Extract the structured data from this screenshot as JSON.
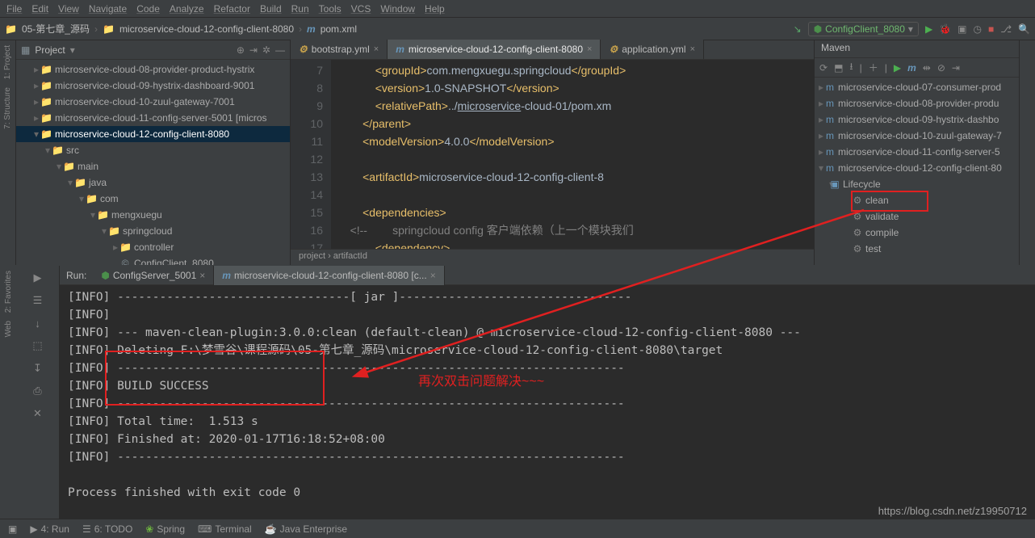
{
  "menu": [
    "File",
    "Edit",
    "View",
    "Navigate",
    "Code",
    "Analyze",
    "Refactor",
    "Build",
    "Run",
    "Tools",
    "VCS",
    "Window",
    "Help"
  ],
  "breadcrumb": {
    "a": "05-第七章_源码",
    "b": "microservice-cloud-12-config-client-8080",
    "c": "pom.xml"
  },
  "runconfig": "ConfigClient_8080",
  "project_label": "Project",
  "tree": [
    {
      "ind": 1,
      "tw": "▸",
      "ic": "📁",
      "t": "microservice-cloud-08-provider-product-hystrix"
    },
    {
      "ind": 1,
      "tw": "▸",
      "ic": "📁",
      "t": "microservice-cloud-09-hystrix-dashboard-9001"
    },
    {
      "ind": 1,
      "tw": "▸",
      "ic": "📁",
      "t": "microservice-cloud-10-zuul-gateway-7001"
    },
    {
      "ind": 1,
      "tw": "▸",
      "ic": "📁",
      "t": "microservice-cloud-11-config-server-5001 [micros"
    },
    {
      "ind": 1,
      "tw": "▾",
      "ic": "📁",
      "t": "microservice-cloud-12-config-client-8080",
      "sel": true
    },
    {
      "ind": 2,
      "tw": "▾",
      "ic": "📁",
      "t": "src"
    },
    {
      "ind": 3,
      "tw": "▾",
      "ic": "📁",
      "t": "main"
    },
    {
      "ind": 4,
      "tw": "▾",
      "ic": "📁",
      "t": "java"
    },
    {
      "ind": 5,
      "tw": "▾",
      "ic": "📁",
      "t": "com"
    },
    {
      "ind": 6,
      "tw": "▾",
      "ic": "📁",
      "t": "mengxuegu"
    },
    {
      "ind": 7,
      "tw": "▾",
      "ic": "📁",
      "t": "springcloud"
    },
    {
      "ind": 8,
      "tw": "▸",
      "ic": "📁",
      "t": "controller"
    },
    {
      "ind": 8,
      "tw": "",
      "ic": "©",
      "t": "ConfigClient_8080",
      "cls": "java"
    }
  ],
  "tabs": [
    {
      "ic": "⚙",
      "t": "bootstrap.yml",
      "a": false,
      "c": "#c7a24c"
    },
    {
      "ic": "m",
      "t": "microservice-cloud-12-config-client-8080",
      "a": true,
      "c": "#6897bb"
    },
    {
      "ic": "⚙",
      "t": "application.yml",
      "a": false,
      "c": "#c7a24c"
    }
  ],
  "gutter_start": 7,
  "gutter_end": 17,
  "code_lines": [
    {
      "pad": "            ",
      "segs": [
        [
          "tag",
          "<groupId>"
        ],
        [
          "txt",
          "com.mengxuegu.springcloud"
        ],
        [
          "tag",
          "</groupId>"
        ]
      ]
    },
    {
      "pad": "            ",
      "segs": [
        [
          "tag",
          "<version>"
        ],
        [
          "txt",
          "1.0-SNAPSHOT"
        ],
        [
          "tag",
          "</version>"
        ]
      ]
    },
    {
      "pad": "            ",
      "segs": [
        [
          "tag",
          "<relativePath>"
        ],
        [
          "txt",
          "../"
        ],
        [
          "url",
          "microservice"
        ],
        [
          "txt",
          "-cloud-01/pom.xm"
        ]
      ]
    },
    {
      "pad": "        ",
      "segs": [
        [
          "tag",
          "</parent>"
        ]
      ]
    },
    {
      "pad": "        ",
      "segs": [
        [
          "tag",
          "<modelVersion>"
        ],
        [
          "txt",
          "4.0.0"
        ],
        [
          "tag",
          "</modelVersion>"
        ]
      ]
    },
    {
      "pad": "",
      "segs": []
    },
    {
      "pad": "        ",
      "segs": [
        [
          "tag",
          "<artifactId>"
        ],
        [
          "txt",
          "microservice-cloud-12-config-client-8"
        ]
      ]
    },
    {
      "pad": "",
      "segs": []
    },
    {
      "pad": "        ",
      "segs": [
        [
          "tag",
          "<dependencies>"
        ]
      ]
    },
    {
      "pad": "    ",
      "segs": [
        [
          "cmt",
          "<!--        springcloud config 客户端依赖（上一个模块我们"
        ]
      ]
    },
    {
      "pad": "            ",
      "segs": [
        [
          "tag",
          "<dependency>"
        ]
      ]
    }
  ],
  "crumbs": "project  ›  artifactId",
  "maven_label": "Maven",
  "maven_modules": [
    "microservice-cloud-07-consumer-prod",
    "microservice-cloud-08-provider-produ",
    "microservice-cloud-09-hystrix-dashbo",
    "microservice-cloud-10-zuul-gateway-7",
    "microservice-cloud-11-config-server-5",
    "microservice-cloud-12-config-client-80"
  ],
  "lifecycle_label": "Lifecycle",
  "lifecycle": [
    "clean",
    "validate",
    "compile",
    "test"
  ],
  "run_label": "Run:",
  "run_tabs": [
    {
      "t": "ConfigServer_5001",
      "a": false
    },
    {
      "t": "microservice-cloud-12-config-client-8080 [c...",
      "a": true
    }
  ],
  "console": "[INFO] ---------------------------------[ jar ]---------------------------------\n[INFO]\n[INFO] --- maven-clean-plugin:3.0.0:clean (default-clean) @ microservice-cloud-12-config-client-8080 ---\n[INFO] Deleting F:\\梦雪谷\\课程源码\\05-第七章_源码\\microservice-cloud-12-config-client-8080\\target\n[INFO] ------------------------------------------------------------------------\n[INFO] BUILD SUCCESS\n[INFO] ------------------------------------------------------------------------\n[INFO] Total time:  1.513 s\n[INFO] Finished at: 2020-01-17T16:18:52+08:00\n[INFO] ------------------------------------------------------------------------\n\nProcess finished with exit code 0",
  "annotation": "再次双击问题解决~~~",
  "statusbar": {
    "run": "4: Run",
    "todo": "6: TODO",
    "spring": "Spring",
    "terminal": "Terminal",
    "java": "Java Enterprise"
  },
  "watermark": "https://blog.csdn.net/z19950712",
  "sidetabs": {
    "project": "1: Project",
    "structure": "7: Structure",
    "fav": "2: Favorites",
    "web": "Web"
  }
}
